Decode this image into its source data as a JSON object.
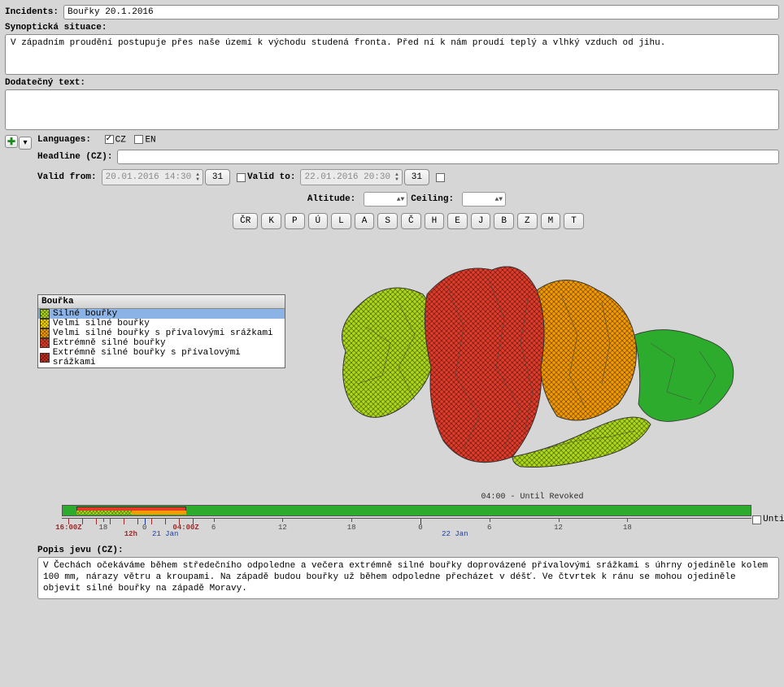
{
  "labels": {
    "incidents": "Incidents:",
    "synoptic": "Synoptická situace:",
    "additional": "Dodatečný text:",
    "languages": "Languages:",
    "headline": "Headline (CZ):",
    "valid_from": "Valid from:",
    "valid_to": "Valid to:",
    "altitude": "Altitude:",
    "ceiling": "Ceiling:",
    "until_revoked": "Until Revoked",
    "desc_label": "Popis jevu (CZ):",
    "btn31": "31",
    "lang_cz": "CZ",
    "lang_en": "EN",
    "timeline_12h": "12h",
    "map_status": "04:00 - Until Revoked"
  },
  "values": {
    "incidents": "Bouřky 20.1.2016",
    "synoptic_text": "V západním proudění postupuje přes naše území k východu studená fronta. Před ní k nám proudí teplý a vlhký vzduch od jihu.",
    "additional_text": "",
    "headline": "",
    "valid_from": "20.01.2016 14:30",
    "valid_to": "22.01.2016 20:30",
    "desc_text": "V Čechách očekáváme během středečního odpoledne a večera extrémně silné bouřky doprovázené přívalovými srážkami s úhrny ojediněle kolem 100 mm, nárazy větru a kroupami. Na západě budou bouřky už během odpoledne přecházet v déšť. Ve čtvrtek k ránu se mohou ojediněle objevit silné bouřky na západě Moravy."
  },
  "checked": {
    "cz": true,
    "en": false,
    "valid_to_enable": false,
    "after_valid_to": false,
    "until_revoked": false
  },
  "regions": [
    "ČR",
    "K",
    "P",
    "Ú",
    "L",
    "A",
    "S",
    "Č",
    "H",
    "E",
    "J",
    "B",
    "Z",
    "M",
    "T"
  ],
  "legend": {
    "title": "Bouřka",
    "items": [
      {
        "label": "Silné bouřky",
        "color": "c-green",
        "selected": true
      },
      {
        "label": "Velmi silné bouřky",
        "color": "c-yellow",
        "selected": false
      },
      {
        "label": "Velmi silné bouřky s přívalovými srážkami",
        "color": "c-orange",
        "selected": false
      },
      {
        "label": "Extrémně silné bouřky",
        "color": "c-red",
        "selected": false
      },
      {
        "label": "Extrémně silné bouřky s přívalovými srážkami",
        "color": "c-darkred",
        "selected": false
      }
    ]
  },
  "timeline": {
    "start_label": "16:00Z",
    "end_label": "04:00Z",
    "date1": "21 Jan",
    "date2": "22 Jan",
    "ticks": [
      "18",
      "0",
      "6",
      "12",
      "18",
      "0",
      "6",
      "12",
      "18"
    ]
  },
  "colors": {
    "green": "#2dab2d",
    "limegreen": "#acd91a",
    "yellow": "#f7d700",
    "orange": "#f59a00",
    "red": "#e23b2a"
  }
}
